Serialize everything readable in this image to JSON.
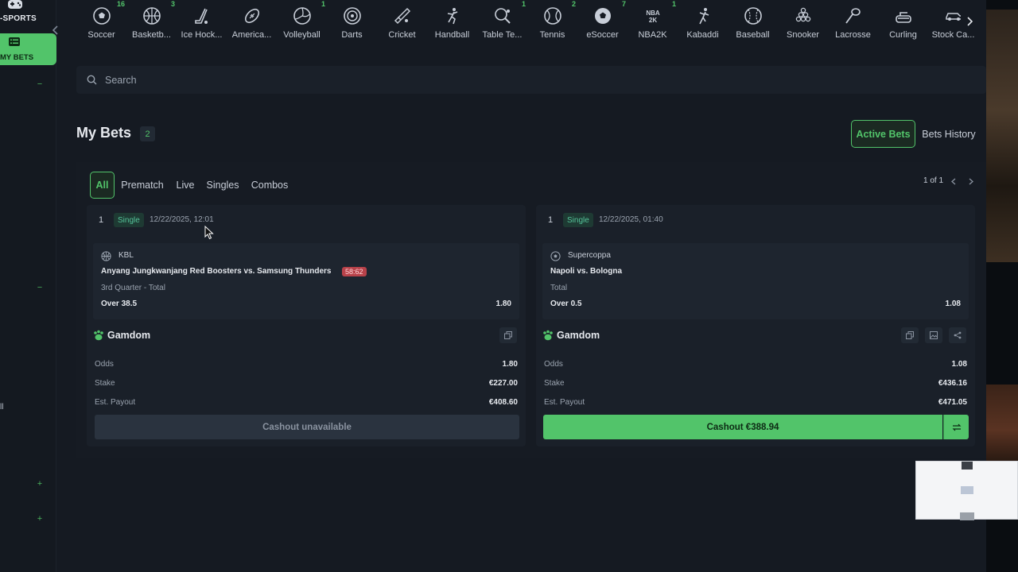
{
  "sidebar": {
    "section_label": "-SPORTS",
    "my_bets_label": "MY BETS",
    "edge_text": "ll",
    "marks": [
      "−",
      "−",
      "+",
      "+"
    ]
  },
  "collapse": {
    "icon": "chevron-left-icon"
  },
  "sports": [
    {
      "name": "Soccer",
      "count": "16",
      "icon": "soccer-ball-icon"
    },
    {
      "name": "Basketb...",
      "count": "3",
      "icon": "basketball-icon"
    },
    {
      "name": "Ice Hock...",
      "count": "",
      "icon": "hockey-stick-icon"
    },
    {
      "name": "America...",
      "count": "",
      "icon": "american-football-icon"
    },
    {
      "name": "Volleyball",
      "count": "1",
      "icon": "volleyball-icon"
    },
    {
      "name": "Darts",
      "count": "",
      "icon": "dartboard-icon"
    },
    {
      "name": "Cricket",
      "count": "",
      "icon": "cricket-bat-icon"
    },
    {
      "name": "Handball",
      "count": "",
      "icon": "handball-player-icon"
    },
    {
      "name": "Table Te...",
      "count": "1",
      "icon": "table-tennis-icon"
    },
    {
      "name": "Tennis",
      "count": "2",
      "icon": "tennis-ball-icon"
    },
    {
      "name": "eSoccer",
      "count": "7",
      "icon": "esoccer-ball-icon"
    },
    {
      "name": "NBA2K",
      "count": "1",
      "icon": "nba2k-icon"
    },
    {
      "name": "Kabaddi",
      "count": "",
      "icon": "kabaddi-icon"
    },
    {
      "name": "Baseball",
      "count": "",
      "icon": "baseball-icon"
    },
    {
      "name": "Snooker",
      "count": "",
      "icon": "snooker-balls-icon"
    },
    {
      "name": "Lacrosse",
      "count": "",
      "icon": "lacrosse-stick-icon"
    },
    {
      "name": "Curling",
      "count": "",
      "icon": "curling-stone-icon"
    },
    {
      "name": "Stock Ca...",
      "count": "",
      "icon": "stock-car-icon"
    }
  ],
  "search": {
    "placeholder": "Search"
  },
  "page": {
    "title": "My Bets",
    "count": "2",
    "active_label": "Active Bets",
    "history_label": "Bets History"
  },
  "filters": [
    "All",
    "Prematch",
    "Live",
    "Singles",
    "Combos"
  ],
  "pagination": {
    "text": "1 of 1"
  },
  "bets": [
    {
      "index": "1",
      "type": "Single",
      "date": "12/22/2025, 12:01",
      "league": "KBL",
      "league_icon": "basketball-icon",
      "match": "Anyang Jungkwanjang Red Boosters vs. Samsung Thunders",
      "score": "58:62",
      "market": "3rd Quarter - Total",
      "pick": "Over 38.5",
      "pick_odds": "1.80",
      "brand": "Gamdom",
      "odds_label": "Odds",
      "odds": "1.80",
      "stake_label": "Stake",
      "stake": "€227.00",
      "payout_label": "Est. Payout",
      "payout": "€408.60",
      "cashout": "Cashout unavailable"
    },
    {
      "index": "1",
      "type": "Single",
      "date": "12/22/2025, 01:40",
      "league": "Supercoppa",
      "league_icon": "soccer-ball-icon",
      "match": "Napoli vs. Bologna",
      "market": "Total",
      "pick": "Over 0.5",
      "pick_odds": "1.08",
      "brand": "Gamdom",
      "odds_label": "Odds",
      "odds": "1.08",
      "stake_label": "Stake",
      "stake": "€436.16",
      "payout_label": "Est. Payout",
      "payout": "€471.05",
      "cashout": "Cashout €388.94"
    }
  ],
  "colors": {
    "accent": "#52c46a",
    "background": "#151a22",
    "card": "#1a2029",
    "live_score": "#b8424a"
  }
}
